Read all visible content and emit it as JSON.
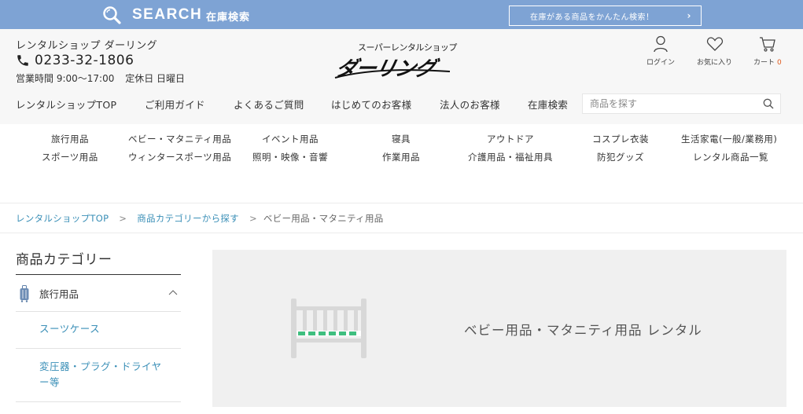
{
  "topbar": {
    "search_word": "SEARCH",
    "search_sub": "在庫検索",
    "easy_search_label": "在庫がある商品をかんたん検索！",
    "chevron": "›"
  },
  "header": {
    "shop_name": "レンタルショップ ダーリング",
    "phone": "0233-32-1806",
    "hours": "営業時間 9:00～17:00",
    "holiday": "定休日 日曜日",
    "logo_sub": "スーパーレンタルショップ",
    "logo_main": "ダーリング",
    "login_label": "ログイン",
    "favorites_label": "お気に入り",
    "cart_label": "カート",
    "cart_count": "0",
    "cart_count_color": "#e0591b"
  },
  "nav": {
    "items": [
      "レンタルショップTOP",
      "ご利用ガイド",
      "よくあるご質問",
      "はじめてのお客様",
      "法人のお客様",
      "在庫検索"
    ],
    "search_placeholder": "商品を探す"
  },
  "categories": {
    "row1": [
      "旅行用品",
      "ベビー・マタニティ用品",
      "イベント用品",
      "寝具",
      "アウトドア",
      "コスプレ衣装",
      "生活家電(一般/業務用)"
    ],
    "row2": [
      "スポーツ用品",
      "ウィンタースポーツ用品",
      "照明・映像・音響",
      "作業用品",
      "介護用品・福祉用具",
      "防犯グッズ",
      "レンタル商品一覧"
    ]
  },
  "breadcrumb": {
    "home": "レンタルショップTOP",
    "parent": "商品カテゴリーから探す",
    "current": "ベビー用品・マタニティ用品",
    "separator": ">"
  },
  "sidebar": {
    "title": "商品カテゴリー",
    "parent_label": "旅行用品",
    "children": [
      "スーツケース",
      "変圧器・プラグ・ドライヤー等"
    ]
  },
  "banner": {
    "text": "ベビー用品・マタニティ用品 レンタル",
    "icon": "crib-icon",
    "accent": "#3fbf7f"
  },
  "colors": {
    "topbar": "#7ea3d4",
    "link": "#3a8fb7",
    "header_bg": "#f7f7f7"
  }
}
